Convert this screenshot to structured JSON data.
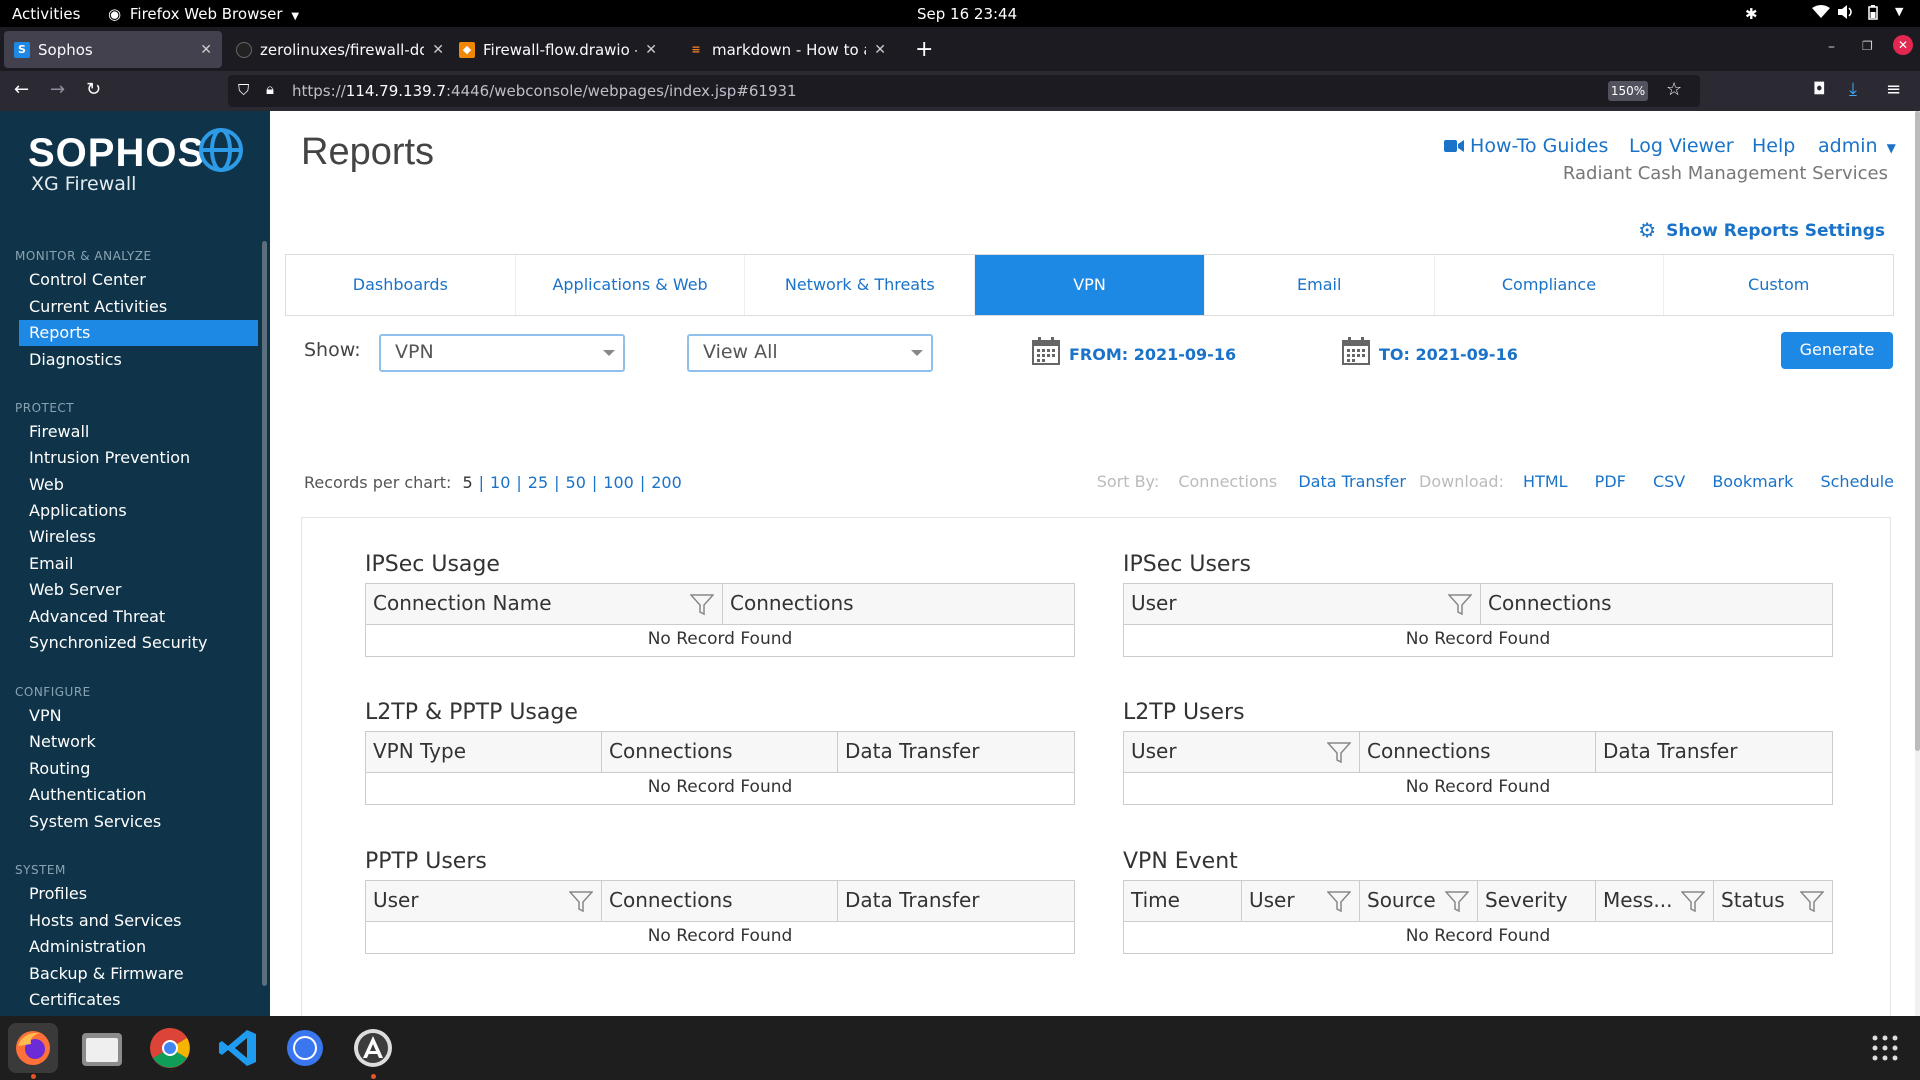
{
  "system_bar": {
    "activities": "Activities",
    "app_name": "Firefox Web Browser",
    "clock": "Sep 16  23:44"
  },
  "browser": {
    "tabs": [
      {
        "title": "Sophos",
        "active": true
      },
      {
        "title": "zerolinuxes/firewall-docs",
        "active": false
      },
      {
        "title": "Firewall-flow.drawio - dia",
        "active": false
      },
      {
        "title": "markdown - How to add i",
        "active": false
      }
    ],
    "url_prefix": "https://",
    "url_host": "114.79.139.7",
    "url_rest": ":4446/webconsole/webpages/index.jsp#61931",
    "zoom": "150%"
  },
  "sidebar": {
    "logo": "SOPHOS",
    "product": "XG Firewall",
    "sections": [
      {
        "title": "MONITOR & ANALYZE",
        "items": [
          "Control Center",
          "Current Activities",
          "Reports",
          "Diagnostics"
        ]
      },
      {
        "title": "PROTECT",
        "items": [
          "Firewall",
          "Intrusion Prevention",
          "Web",
          "Applications",
          "Wireless",
          "Email",
          "Web Server",
          "Advanced Threat",
          "Synchronized Security"
        ]
      },
      {
        "title": "CONFIGURE",
        "items": [
          "VPN",
          "Network",
          "Routing",
          "Authentication",
          "System Services"
        ]
      },
      {
        "title": "SYSTEM",
        "items": [
          "Profiles",
          "Hosts and Services",
          "Administration",
          "Backup & Firmware",
          "Certificates"
        ]
      }
    ],
    "selected": "Reports"
  },
  "header": {
    "title": "Reports",
    "links": {
      "howto": "How-To Guides",
      "logviewer": "Log Viewer",
      "help": "Help",
      "admin": "admin"
    },
    "company": "Radiant Cash Management Services",
    "settings_link": "Show Reports Settings"
  },
  "report_tabs": [
    "Dashboards",
    "Applications & Web",
    "Network & Threats",
    "VPN",
    "Email",
    "Compliance",
    "Custom"
  ],
  "active_tab": "VPN",
  "filters": {
    "show_label": "Show:",
    "show_value": "VPN",
    "view_value": "View All",
    "from": "FROM: 2021-09-16",
    "to": "TO: 2021-09-16",
    "generate": "Generate"
  },
  "records": {
    "label": "Records per chart:",
    "options": [
      "5",
      "10",
      "25",
      "50",
      "100",
      "200"
    ],
    "selected": "5"
  },
  "toolbar": {
    "sort_by": "Sort By:",
    "sort_connections": "Connections",
    "sort_data_transfer": "Data Transfer",
    "download": "Download:",
    "html": "HTML",
    "pdf": "PDF",
    "csv": "CSV",
    "bookmark": "Bookmark",
    "schedule": "Schedule"
  },
  "widgets": {
    "ipsec_usage": {
      "title": "IPSec Usage",
      "columns": [
        "Connection Name",
        "Connections"
      ],
      "empty": "No Record Found"
    },
    "ipsec_users": {
      "title": "IPSec Users",
      "columns": [
        "User",
        "Connections"
      ],
      "empty": "No Record Found"
    },
    "l2tp_pptp_usage": {
      "title": "L2TP & PPTP Usage",
      "columns": [
        "VPN Type",
        "Connections",
        "Data Transfer"
      ],
      "empty": "No Record Found"
    },
    "l2tp_users": {
      "title": "L2TP Users",
      "columns": [
        "User",
        "Connections",
        "Data Transfer"
      ],
      "empty": "No Record Found"
    },
    "pptp_users": {
      "title": "PPTP Users",
      "columns": [
        "User",
        "Connections",
        "Data Transfer"
      ],
      "empty": "No Record Found"
    },
    "vpn_event": {
      "title": "VPN Event",
      "columns": [
        "Time",
        "User",
        "Source",
        "Severity",
        "Mess...",
        "Status"
      ],
      "empty": "No Record Found"
    }
  },
  "colors": {
    "accent": "#1e88e5",
    "sidebar": "#0f3449",
    "link": "#1a73c8"
  }
}
